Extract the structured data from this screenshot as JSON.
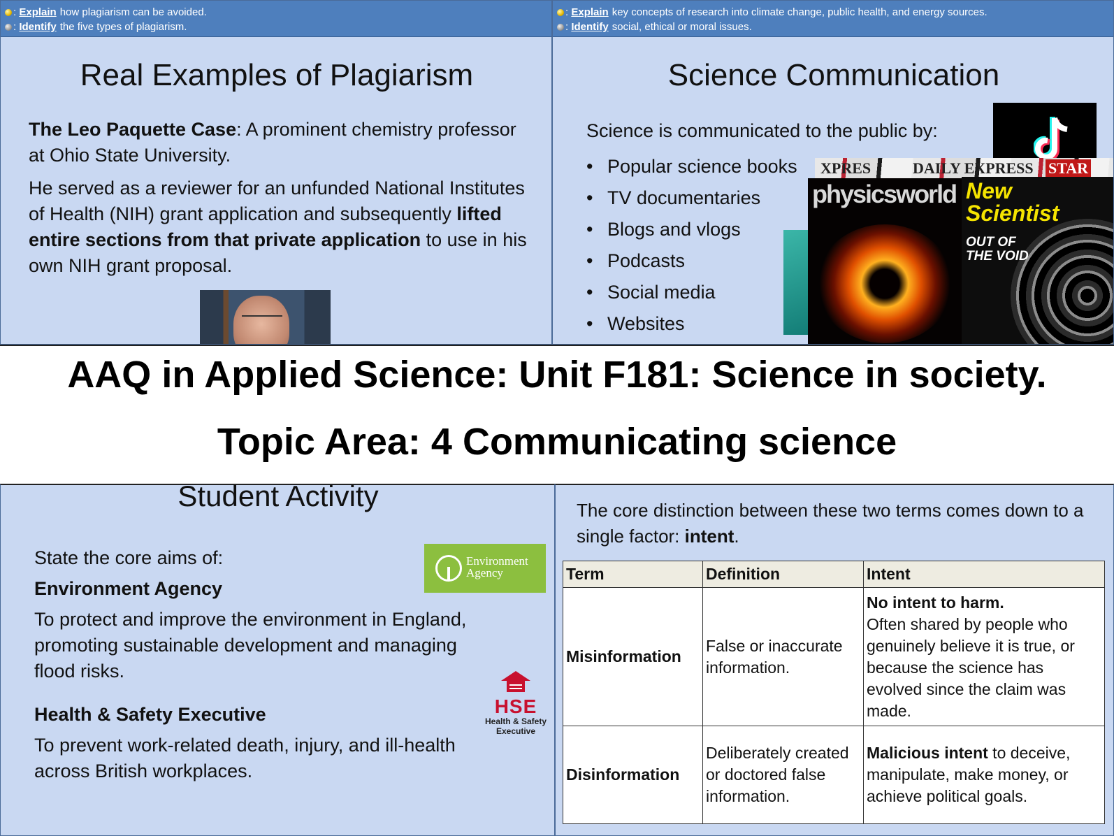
{
  "top_left": {
    "objectives": [
      {
        "verb": "Explain",
        "text": "how plagiarism can be avoided."
      },
      {
        "verb": "Identify",
        "text": "the five types of plagiarism."
      }
    ],
    "title": "Real Examples of Plagiarism",
    "case_name": "The Leo Paquette Case",
    "case_intro": ": A prominent chemistry professor at Ohio State University.",
    "para2_start": "He served as a reviewer for an unfunded National Institutes of Health (NIH) grant application and subsequently ",
    "para2_bold": "lifted entire sections from that private application",
    "para2_end": " to use in his own NIH grant proposal."
  },
  "top_right": {
    "objectives": [
      {
        "verb": "Explain",
        "text": "key concepts of research into climate change, public health, and energy sources."
      },
      {
        "verb": "Identify",
        "text": "social, ethical or moral issues."
      }
    ],
    "title": "Science Communication",
    "intro": "Science is communicated to the public by:",
    "items": [
      "Popular science books",
      "TV documentaries",
      "Blogs and vlogs",
      "Podcasts",
      "Social media",
      "Websites"
    ],
    "magazines": {
      "newspaper_mast_1": "XPRES",
      "newspaper_mast_2": "DAILY EXPRESS",
      "newspaper_mast_3": "STAR",
      "physics": "physicsworld",
      "newsci_line1": "New",
      "newsci_line2": "Scientist",
      "newsci_cover_1": "OUT OF",
      "newsci_cover_2": "THE VOID"
    }
  },
  "banner": {
    "line1": "AAQ in Applied Science: Unit F181: Science in society.",
    "line2": "Topic Area: 4 Communicating science"
  },
  "bottom_left": {
    "title": "Student Activity",
    "prompt": "State the core aims of:",
    "org1_name": "Environment Agency",
    "org1_aim": "To protect and improve the environment in England, promoting sustainable development and managing flood risks.",
    "org2_name": "Health & Safety Executive",
    "org2_aim": "To prevent work-related death, injury, and ill-health across British workplaces.",
    "env_logo_line1": "Environment",
    "env_logo_line2": "Agency",
    "hse_logo_big": "HSE",
    "hse_logo_small1": "Health & Safety",
    "hse_logo_small2": "Executive"
  },
  "bottom_right": {
    "intro": "The core distinction between these two terms comes down to a single factor: ",
    "intro_bold": "intent",
    "intro_end": ".",
    "headers": [
      "Term",
      "Definition",
      "Intent"
    ],
    "rows": [
      {
        "term": "Misinformation",
        "definition": "False or inaccurate information.",
        "intent_bold": "No intent to harm.",
        "intent_rest": "Often shared by people who genuinely believe it is true, or because the science has evolved since the claim was made."
      },
      {
        "term": "Disinformation",
        "definition": "Deliberately created or doctored false information.",
        "intent_bold": "Malicious intent",
        "intent_rest": " to deceive, manipulate, make money, or achieve political goals."
      }
    ]
  }
}
